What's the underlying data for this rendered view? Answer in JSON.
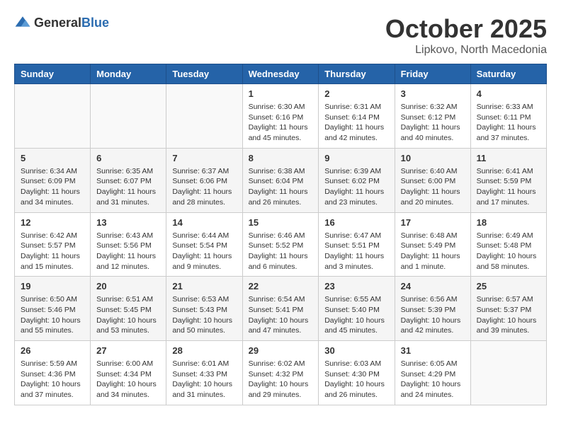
{
  "logo": {
    "general": "General",
    "blue": "Blue"
  },
  "title": "October 2025",
  "location": "Lipkovo, North Macedonia",
  "days_of_week": [
    "Sunday",
    "Monday",
    "Tuesday",
    "Wednesday",
    "Thursday",
    "Friday",
    "Saturday"
  ],
  "weeks": [
    [
      {
        "day": "",
        "info": ""
      },
      {
        "day": "",
        "info": ""
      },
      {
        "day": "",
        "info": ""
      },
      {
        "day": "1",
        "info": "Sunrise: 6:30 AM\nSunset: 6:16 PM\nDaylight: 11 hours and 45 minutes."
      },
      {
        "day": "2",
        "info": "Sunrise: 6:31 AM\nSunset: 6:14 PM\nDaylight: 11 hours and 42 minutes."
      },
      {
        "day": "3",
        "info": "Sunrise: 6:32 AM\nSunset: 6:12 PM\nDaylight: 11 hours and 40 minutes."
      },
      {
        "day": "4",
        "info": "Sunrise: 6:33 AM\nSunset: 6:11 PM\nDaylight: 11 hours and 37 minutes."
      }
    ],
    [
      {
        "day": "5",
        "info": "Sunrise: 6:34 AM\nSunset: 6:09 PM\nDaylight: 11 hours and 34 minutes."
      },
      {
        "day": "6",
        "info": "Sunrise: 6:35 AM\nSunset: 6:07 PM\nDaylight: 11 hours and 31 minutes."
      },
      {
        "day": "7",
        "info": "Sunrise: 6:37 AM\nSunset: 6:06 PM\nDaylight: 11 hours and 28 minutes."
      },
      {
        "day": "8",
        "info": "Sunrise: 6:38 AM\nSunset: 6:04 PM\nDaylight: 11 hours and 26 minutes."
      },
      {
        "day": "9",
        "info": "Sunrise: 6:39 AM\nSunset: 6:02 PM\nDaylight: 11 hours and 23 minutes."
      },
      {
        "day": "10",
        "info": "Sunrise: 6:40 AM\nSunset: 6:00 PM\nDaylight: 11 hours and 20 minutes."
      },
      {
        "day": "11",
        "info": "Sunrise: 6:41 AM\nSunset: 5:59 PM\nDaylight: 11 hours and 17 minutes."
      }
    ],
    [
      {
        "day": "12",
        "info": "Sunrise: 6:42 AM\nSunset: 5:57 PM\nDaylight: 11 hours and 15 minutes."
      },
      {
        "day": "13",
        "info": "Sunrise: 6:43 AM\nSunset: 5:56 PM\nDaylight: 11 hours and 12 minutes."
      },
      {
        "day": "14",
        "info": "Sunrise: 6:44 AM\nSunset: 5:54 PM\nDaylight: 11 hours and 9 minutes."
      },
      {
        "day": "15",
        "info": "Sunrise: 6:46 AM\nSunset: 5:52 PM\nDaylight: 11 hours and 6 minutes."
      },
      {
        "day": "16",
        "info": "Sunrise: 6:47 AM\nSunset: 5:51 PM\nDaylight: 11 hours and 3 minutes."
      },
      {
        "day": "17",
        "info": "Sunrise: 6:48 AM\nSunset: 5:49 PM\nDaylight: 11 hours and 1 minute."
      },
      {
        "day": "18",
        "info": "Sunrise: 6:49 AM\nSunset: 5:48 PM\nDaylight: 10 hours and 58 minutes."
      }
    ],
    [
      {
        "day": "19",
        "info": "Sunrise: 6:50 AM\nSunset: 5:46 PM\nDaylight: 10 hours and 55 minutes."
      },
      {
        "day": "20",
        "info": "Sunrise: 6:51 AM\nSunset: 5:45 PM\nDaylight: 10 hours and 53 minutes."
      },
      {
        "day": "21",
        "info": "Sunrise: 6:53 AM\nSunset: 5:43 PM\nDaylight: 10 hours and 50 minutes."
      },
      {
        "day": "22",
        "info": "Sunrise: 6:54 AM\nSunset: 5:41 PM\nDaylight: 10 hours and 47 minutes."
      },
      {
        "day": "23",
        "info": "Sunrise: 6:55 AM\nSunset: 5:40 PM\nDaylight: 10 hours and 45 minutes."
      },
      {
        "day": "24",
        "info": "Sunrise: 6:56 AM\nSunset: 5:39 PM\nDaylight: 10 hours and 42 minutes."
      },
      {
        "day": "25",
        "info": "Sunrise: 6:57 AM\nSunset: 5:37 PM\nDaylight: 10 hours and 39 minutes."
      }
    ],
    [
      {
        "day": "26",
        "info": "Sunrise: 5:59 AM\nSunset: 4:36 PM\nDaylight: 10 hours and 37 minutes."
      },
      {
        "day": "27",
        "info": "Sunrise: 6:00 AM\nSunset: 4:34 PM\nDaylight: 10 hours and 34 minutes."
      },
      {
        "day": "28",
        "info": "Sunrise: 6:01 AM\nSunset: 4:33 PM\nDaylight: 10 hours and 31 minutes."
      },
      {
        "day": "29",
        "info": "Sunrise: 6:02 AM\nSunset: 4:32 PM\nDaylight: 10 hours and 29 minutes."
      },
      {
        "day": "30",
        "info": "Sunrise: 6:03 AM\nSunset: 4:30 PM\nDaylight: 10 hours and 26 minutes."
      },
      {
        "day": "31",
        "info": "Sunrise: 6:05 AM\nSunset: 4:29 PM\nDaylight: 10 hours and 24 minutes."
      },
      {
        "day": "",
        "info": ""
      }
    ]
  ]
}
